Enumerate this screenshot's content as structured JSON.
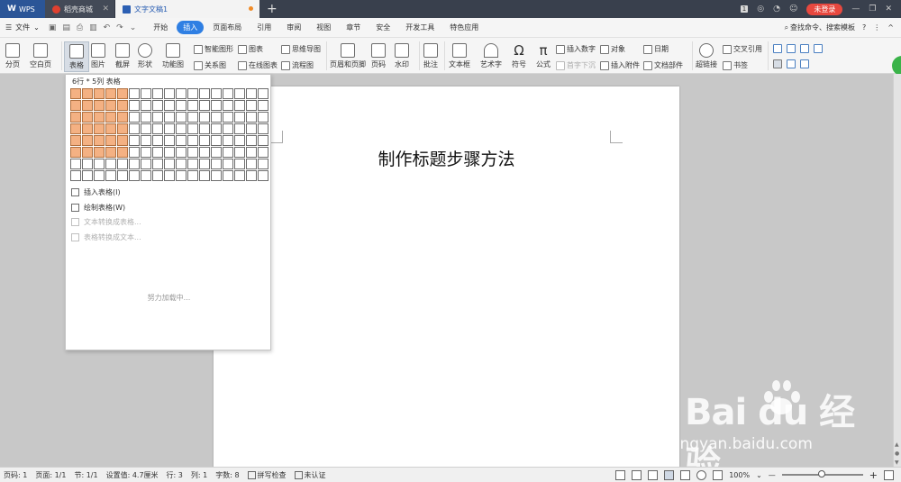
{
  "titlebar": {
    "tabs": [
      {
        "label": "WPS",
        "icon": "wps-logo-icon"
      },
      {
        "label": "稻壳商城",
        "icon": "daoke-icon"
      },
      {
        "label": "文字文稿1",
        "icon": "document-icon"
      }
    ],
    "page_count": "1",
    "login_label": "未登录"
  },
  "menubar": {
    "file_label": "文件",
    "tabs": [
      "开始",
      "插入",
      "页面布局",
      "引用",
      "审阅",
      "视图",
      "章节",
      "安全",
      "开发工具",
      "特色应用"
    ],
    "active_tab": "插入",
    "search_label": "查找命令、搜索模板"
  },
  "ribbon": {
    "page_break": "分页",
    "blank_page": "空白页",
    "table": "表格",
    "picture": "图片",
    "screenshot": "截屏",
    "shape": "形状",
    "function_chart": "功能图",
    "smart_shape": "智能图形",
    "chart": "图表",
    "mind_map": "思维导图",
    "relation_chart": "关系图",
    "online_chart": "在线图表",
    "flowchart": "流程图",
    "header_footer": "页眉和页脚",
    "page_number": "页码",
    "watermark": "水印",
    "comment": "批注",
    "textbox": "文本框",
    "art_text": "艺术字",
    "symbol": "符号",
    "formula": "公式",
    "insert_number": "插入数字",
    "first_sink": "首字下沉",
    "object": "对象",
    "insert_attachment": "插入附件",
    "date": "日期",
    "doc_parts": "文档部件",
    "hyperlink": "超链接",
    "cross_ref": "交叉引用",
    "bookmark": "书签"
  },
  "dropdown": {
    "caption": "6行 * 5列 表格",
    "rows": 8,
    "cols": 17,
    "selected_rows": 6,
    "selected_cols": 5,
    "items": [
      {
        "label": "插入表格(I)",
        "enabled": true
      },
      {
        "label": "绘制表格(W)",
        "enabled": true
      },
      {
        "label": "文本转换成表格...",
        "enabled": false
      },
      {
        "label": "表格转换成文本...",
        "enabled": false
      }
    ],
    "loading": "努力加载中..."
  },
  "document": {
    "title": "制作标题步骤方法"
  },
  "watermark": {
    "logo": "Bai  du 经验",
    "url": "jingyan.baidu.com"
  },
  "statusbar": {
    "page_no": "页码: 1",
    "pages": "页面: 1/1",
    "section": "节: 1/1",
    "set_value": "设置值: 4.7厘米",
    "row": "行: 3",
    "col": "列: 1",
    "word_count": "字数: 8",
    "spell_check": "拼写检查",
    "certification": "未认证",
    "zoom": "100%"
  },
  "colors": {
    "accent": "#2f7fe3",
    "grid_selected": "#f4b183",
    "login": "#e8483f",
    "titlebar": "#39404d"
  }
}
